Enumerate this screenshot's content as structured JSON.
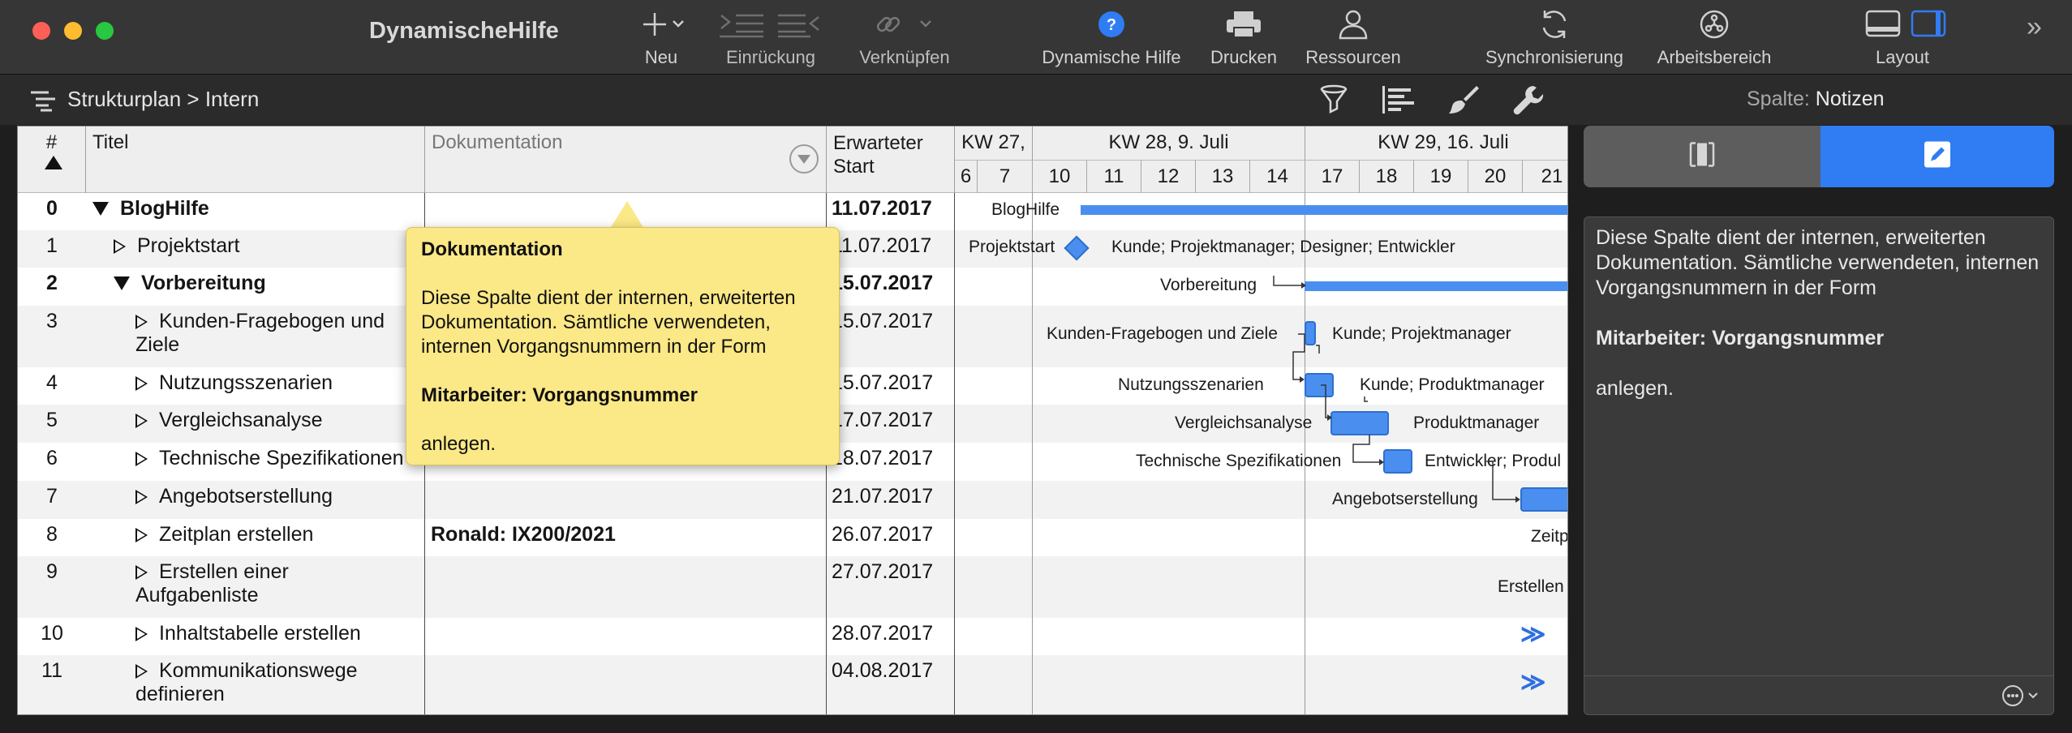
{
  "window": {
    "title": "DynamischeHilfe"
  },
  "toolbar": {
    "items": [
      {
        "label": "Neu",
        "icon": "plus-icon"
      },
      {
        "label": "Einrückung",
        "icon": "indent-icon"
      },
      {
        "label": "Verknüpfen",
        "icon": "link-icon"
      },
      {
        "label": "Dynamische Hilfe",
        "icon": "help-icon"
      },
      {
        "label": "Drucken",
        "icon": "printer-icon"
      },
      {
        "label": "Ressourcen",
        "icon": "person-icon"
      },
      {
        "label": "Synchronisierung",
        "icon": "sync-icon"
      },
      {
        "label": "Arbeitsbereich",
        "icon": "workspace-icon"
      },
      {
        "label": "Layout",
        "icon": "layout-icon"
      }
    ],
    "overflow": "»"
  },
  "breadcrumb": {
    "text": "Strukturplan > Intern"
  },
  "side_panel": {
    "title_prefix": "Spalte:",
    "title_value": "Notizen",
    "notes_line1": "Diese Spalte dient der internen, erweiterten Dokumentation. Sämtliche verwendeten, internen Vorgangsnummern in der Form",
    "notes_bold": "Mitarbeiter: Vorgangsnummer",
    "notes_line3": "anlegen."
  },
  "table": {
    "headers": {
      "num": "#",
      "title": "Titel",
      "doc": "Dokumentation",
      "start": "Erwarteter Start"
    },
    "weeks": [
      "KW 27,",
      "KW 28, 9. Juli",
      "KW 29, 16. Juli"
    ],
    "days": [
      "6",
      "7",
      "10",
      "11",
      "12",
      "13",
      "14",
      "17",
      "18",
      "19",
      "20",
      "21"
    ],
    "rows": [
      {
        "num": "0",
        "title": "BlogHilfe",
        "doc": "",
        "start": "11.07.2017"
      },
      {
        "num": "1",
        "title": "Projektstart",
        "doc": "",
        "start": "11.07.2017"
      },
      {
        "num": "2",
        "title": "Vorbereitung",
        "doc": "",
        "start": "15.07.2017"
      },
      {
        "num": "3",
        "title": "Kunden-Fragebogen und Ziele",
        "doc": "",
        "start": "15.07.2017"
      },
      {
        "num": "4",
        "title": "Nutzungsszenarien",
        "doc": "",
        "start": "15.07.2017"
      },
      {
        "num": "5",
        "title": "Vergleichsanalyse",
        "doc": "",
        "start": "17.07.2017"
      },
      {
        "num": "6",
        "title": "Technische Spezifikationen",
        "doc": "",
        "start": "18.07.2017"
      },
      {
        "num": "7",
        "title": "Angebotserstellung",
        "doc": "",
        "start": "21.07.2017"
      },
      {
        "num": "8",
        "title": "Zeitplan erstellen",
        "doc": "Ronald: IX200/2021",
        "start": "26.07.2017"
      },
      {
        "num": "9",
        "title": "Erstellen einer Aufgabenliste",
        "doc": "",
        "start": "27.07.2017"
      },
      {
        "num": "10",
        "title": "Inhaltstabelle erstellen",
        "doc": "",
        "start": "28.07.2017"
      },
      {
        "num": "11",
        "title": "Kommunikationswege definieren",
        "doc": "",
        "start": "04.08.2017"
      }
    ]
  },
  "gantt": {
    "labels": {
      "r0_left": "BlogHilfe",
      "r1_left": "Projektstart",
      "r1_right": "Kunde; Projektmanager; Designer; Entwickler",
      "r2_left": "Vorbereitung",
      "r3_left": "Kunden-Fragebogen und Ziele",
      "r3_right": "Kunde; Projektmanager",
      "r4_left": "Nutzungsszenarien",
      "r4_right": "Kunde; Produktmanager",
      "r5_left": "Vergleichsanalyse",
      "r5_right": "Produktmanager",
      "r6_left": "Technische Spezifikationen",
      "r6_right": "Entwickler; Produl",
      "r7_left": "Angebotserstellung",
      "r8_left": "Zeitp",
      "r9_left": "Erstellen",
      "more": "≫"
    }
  },
  "tooltip": {
    "title": "Dokumentation",
    "body1": "Diese Spalte dient der internen, erweiterten Dokumentation. Sämtliche verwendeten, internen Vorgangsnummern in der Form",
    "body_bold": "Mitarbeiter: Vorgangsnummer",
    "body3": "anlegen."
  },
  "colors": {
    "accent": "#2f7cf3",
    "bar": "#4a8ff0",
    "tooltip": "#fbe886"
  }
}
